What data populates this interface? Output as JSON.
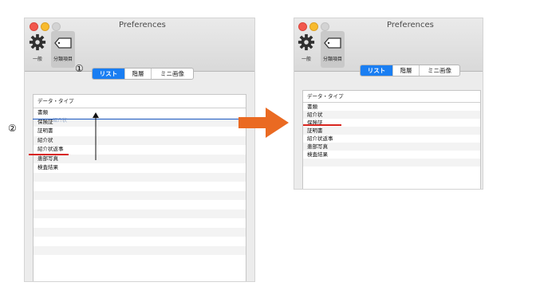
{
  "left_window": {
    "title": "Preferences",
    "toolbar": [
      {
        "label": "一般",
        "icon": "gear-icon"
      },
      {
        "label": "分類項目",
        "icon": "tag-icon"
      }
    ],
    "segments": [
      "リスト",
      "階層",
      "ミニ画像"
    ],
    "active_segment": 0,
    "column_header": "データ・タイプ",
    "rows": [
      "書類",
      "保険証",
      "証明書",
      "紹介状",
      "紹介状返事",
      "患部写真",
      "検査結果",
      "",
      "",
      "",
      "",
      "",
      "",
      "",
      "",
      ""
    ],
    "drag_ghost_label": "紹介状"
  },
  "right_window": {
    "title": "Preferences",
    "toolbar": [
      {
        "label": "一般",
        "icon": "gear-icon"
      },
      {
        "label": "分類項目",
        "icon": "tag-icon"
      }
    ],
    "segments": [
      "リスト",
      "階層",
      "ミニ画像"
    ],
    "active_segment": 0,
    "column_header": "データ・タイプ",
    "rows": [
      "書類",
      "紹介状",
      "保険証",
      "証明書",
      "紹介状返事",
      "患部写真",
      "検査結果",
      "",
      ""
    ]
  },
  "annotations": {
    "step1": "①",
    "step2": "②",
    "arrow_color": "#ea6a22",
    "underline_color": "#d8241e"
  }
}
